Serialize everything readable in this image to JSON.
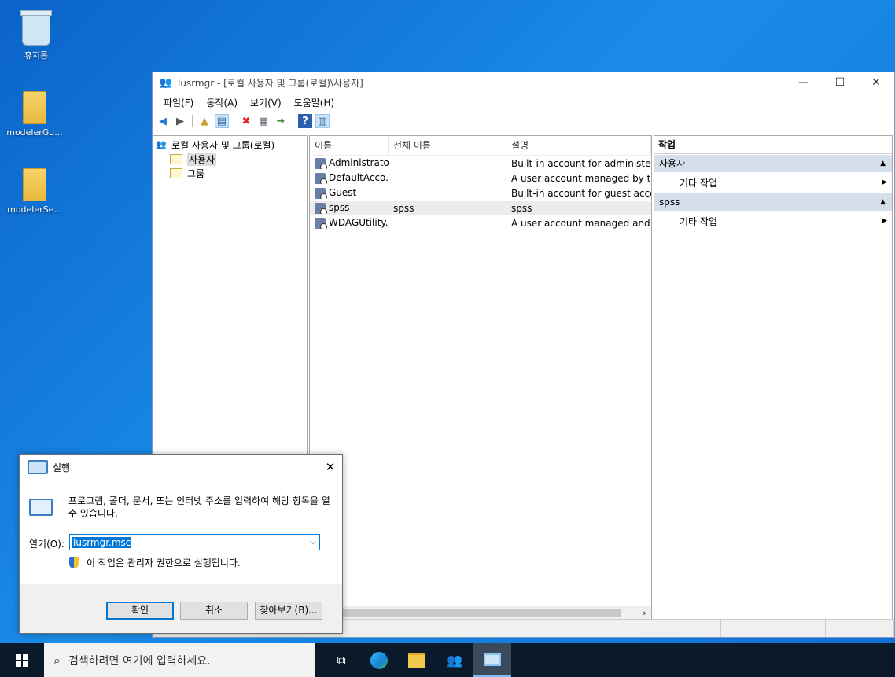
{
  "desktop": {
    "icons": [
      {
        "label": "휴지통"
      },
      {
        "label": "modelerGu..."
      },
      {
        "label": "modelerSe..."
      }
    ]
  },
  "window": {
    "title": "lusrmgr - [로컬 사용자 및 그룹(로컬)\\사용자]",
    "controls": {
      "minimize": "—",
      "maximize": "☐",
      "close": "✕"
    },
    "menu": [
      "파일(F)",
      "동작(A)",
      "보기(V)",
      "도움말(H)"
    ],
    "tree": {
      "root": "로컬 사용자 및 그룹(로컬)",
      "children": [
        "사용자",
        "그룹"
      ]
    },
    "list": {
      "columns": [
        "이름",
        "전체 이름",
        "설명"
      ],
      "rows": [
        {
          "name": "Administrator",
          "full_name": "",
          "description": "Built-in account for administerin"
        },
        {
          "name": "DefaultAcco...",
          "full_name": "",
          "description": "A user account managed by the"
        },
        {
          "name": "Guest",
          "full_name": "",
          "description": "Built-in account for guest access"
        },
        {
          "name": "spss",
          "full_name": "spss",
          "description": "spss"
        },
        {
          "name": "WDAGUtility...",
          "full_name": "",
          "description": "A user account managed and us"
        }
      ]
    },
    "actions": {
      "title": "작업",
      "sections": [
        {
          "label": "사용자",
          "item": "기타 작업"
        },
        {
          "label": "spss",
          "item": "기타 작업"
        }
      ]
    }
  },
  "run_dialog": {
    "title": "실행",
    "description": "프로그램, 폴더, 문서, 또는 인터넷 주소를 입력하여 해당 항목을 열 수 있습니다.",
    "open_label": "열기(O):",
    "input_value": "lusrmgr.msc",
    "admin_note": "이 작업은 관리자 권한으로 실행됩니다.",
    "buttons": {
      "ok": "확인",
      "cancel": "취소",
      "browse": "찾아보기(B)..."
    }
  },
  "taskbar": {
    "search_placeholder": "검색하려면 여기에 입력하세요."
  }
}
